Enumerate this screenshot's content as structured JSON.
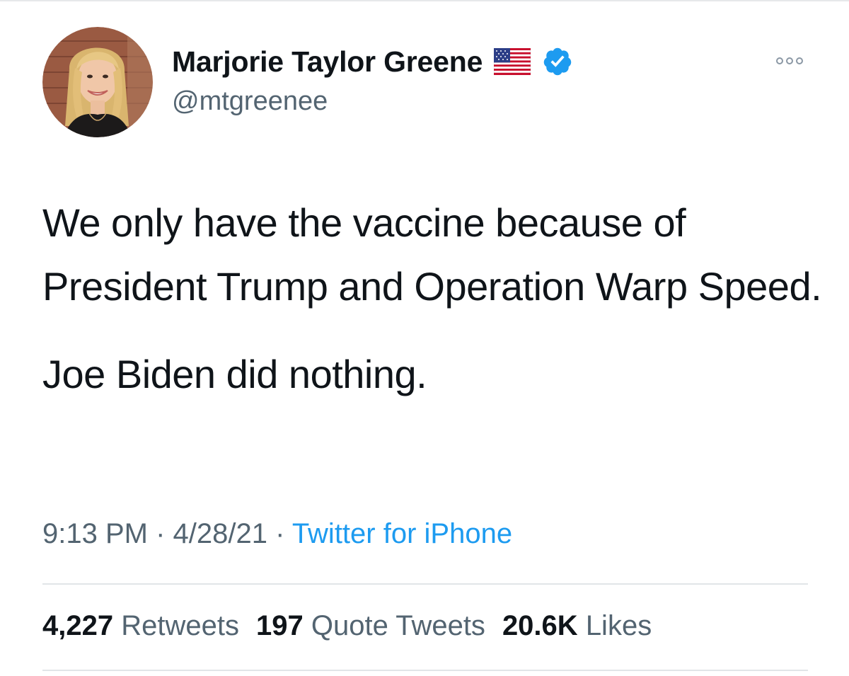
{
  "author": {
    "display_name": "Marjorie Taylor Greene",
    "handle": "@mtgreenee",
    "flag_icon": "us-flag-icon",
    "verified_icon": "verified-badge-icon",
    "verified_color": "#1d9bf0"
  },
  "tweet": {
    "paragraph_1": "We only have the vaccine because of President Trump and Operation Warp Speed.",
    "paragraph_2": "Joe Biden did nothing."
  },
  "meta": {
    "time": "9:13 PM",
    "separator_1": " · ",
    "date": "4/28/21",
    "separator_2": " · ",
    "source": "Twitter for iPhone"
  },
  "stats": {
    "retweets_count": "4,227",
    "retweets_label": "Retweets",
    "quotes_count": "197",
    "quotes_label": "Quote Tweets",
    "likes_count": "20.6K",
    "likes_label": "Likes"
  },
  "colors": {
    "text": "#0f1419",
    "secondary": "#536471",
    "link": "#1d9bf0",
    "divider": "#e1e5e8"
  }
}
